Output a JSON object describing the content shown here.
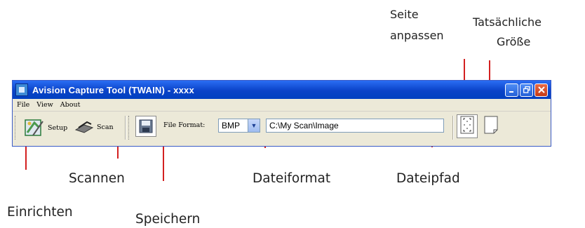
{
  "window": {
    "title": "Avision Capture Tool (TWAIN) -  xxxx",
    "controls": [
      "minimize-icon",
      "restore-icon",
      "close-icon"
    ]
  },
  "menu": {
    "items": [
      "File",
      "View",
      "About"
    ]
  },
  "toolbar": {
    "setup_label": "Setup",
    "scan_label": "Scan",
    "file_format_label": "File Format:",
    "file_format_value": "BMP",
    "file_path_value": "C:\\My Scan\\Image",
    "fit_page_icon": "fit-page-icon",
    "actual_size_icon": "actual-size-icon"
  },
  "callouts": {
    "seite": "Seite anpassen",
    "tatsaechliche_1": "Tatsächliche",
    "tatsaechliche_2": "Größe",
    "scannen": "Scannen",
    "dateiformat": "Dateiformat",
    "dateipfad": "Dateipfad",
    "einrichten": "Einrichten",
    "speichern": "Speichern"
  },
  "colors": {
    "callout_line": "#d32020",
    "titlebar": "#0a43c8",
    "window_bg": "#ece9d8"
  }
}
